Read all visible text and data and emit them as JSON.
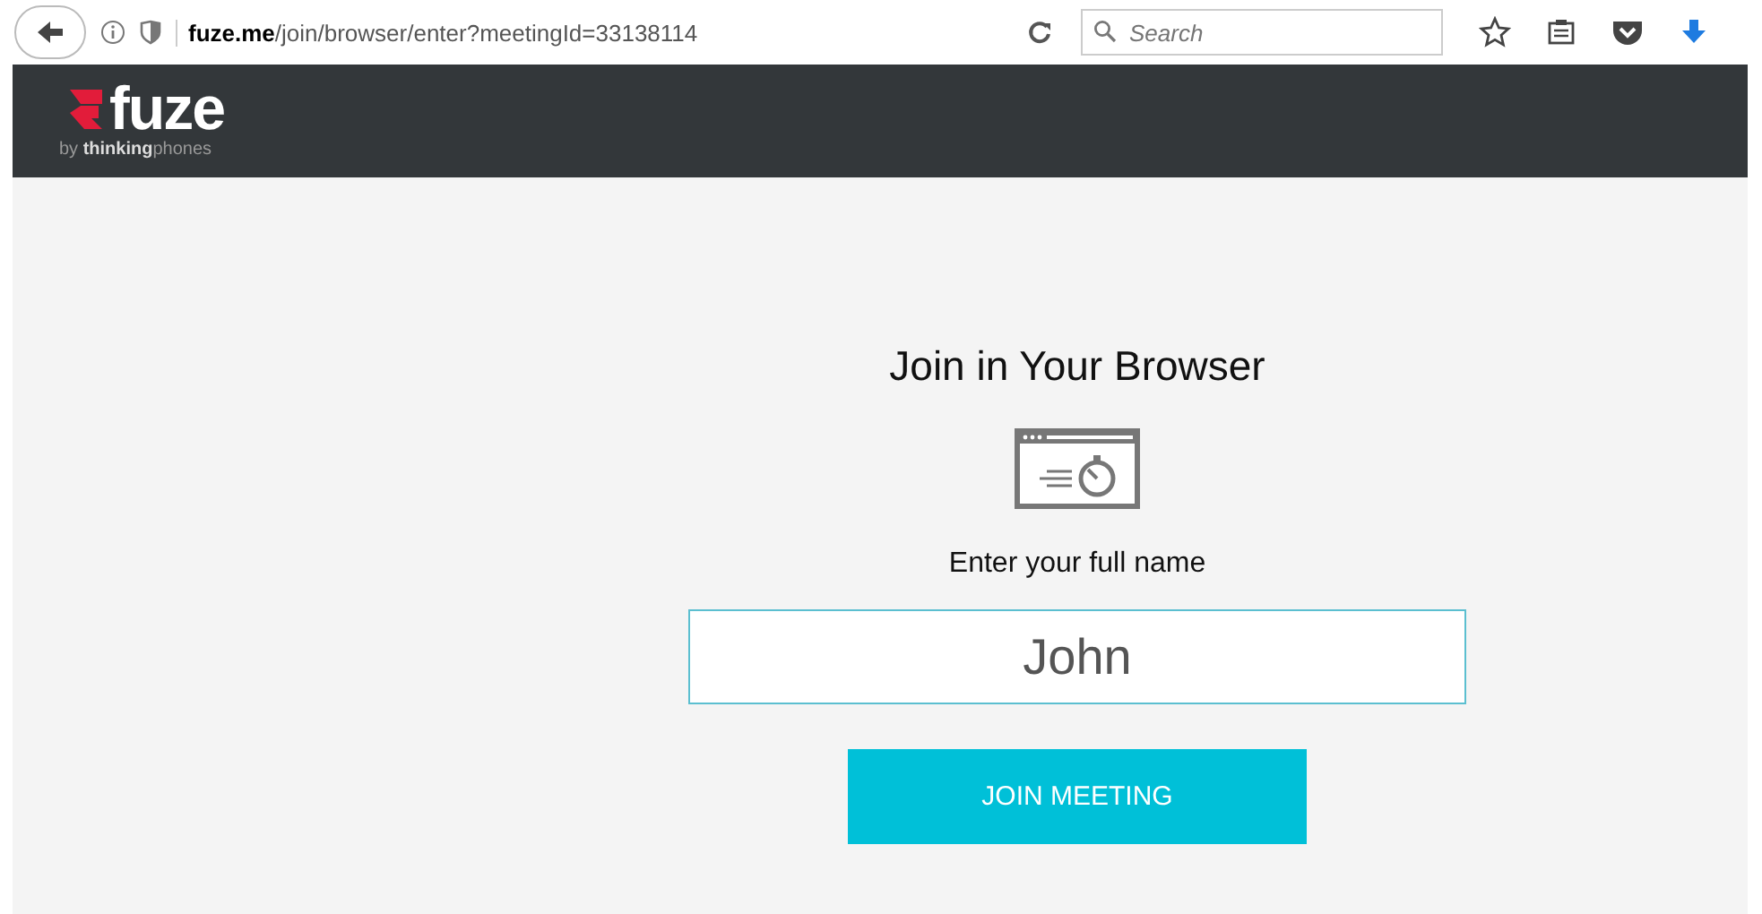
{
  "browser": {
    "url": "**fuze.me**/join/browser/enter?meetingId=33138114",
    "search": {
      "placeholder": "Search"
    }
  },
  "header": {
    "logo": "fuze",
    "tagline": "by **thinking**phones"
  },
  "main": {
    "title": "Join in Your Browser",
    "name_label": "Enter your full name",
    "name_field": {
      "value": "John"
    },
    "button": "JOIN MEETING"
  }
}
